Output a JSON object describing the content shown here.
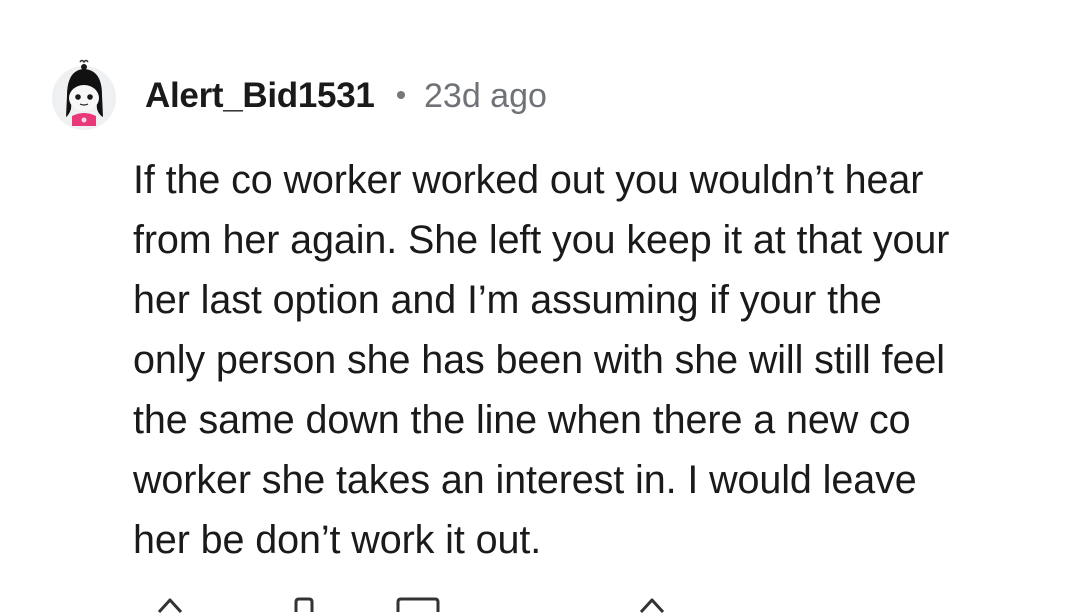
{
  "comment": {
    "author": "Alert_Bid1531",
    "separator": "•",
    "time_ago": "23d ago",
    "text_lines": [
      "If the co worker worked out you wouldn’t hear",
      "from her again. She left you keep it at that your",
      "her last option and I’m assuming if your the",
      "only person she has been with she will still feel",
      "the same down the line when there a new co",
      "worker she takes an interest in. I would leave",
      "her be don’t work it out."
    ],
    "avatar_icon": "user-avatar-snoo-icon",
    "actions": [
      {
        "icon": "upvote-icon"
      },
      {
        "icon": "award-icon"
      },
      {
        "icon": "reply-icon"
      },
      {
        "icon": "downvote-icon"
      }
    ]
  },
  "colors": {
    "text": "#1a1a1b",
    "meta": "#6f7377",
    "background": "#ffffff",
    "avatar_accent": "#e8387a"
  }
}
